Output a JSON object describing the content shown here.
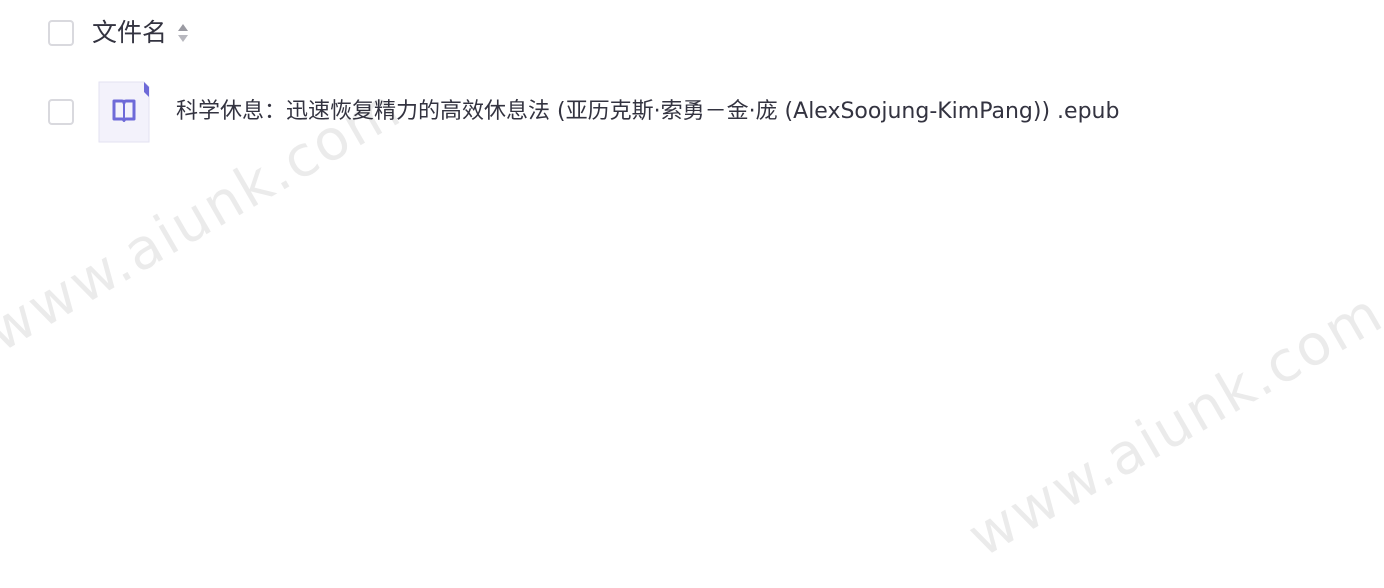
{
  "header": {
    "column_title": "文件名",
    "sort_icon": "sort-arrows-icon"
  },
  "files": [
    {
      "name": "科学休息：迅速恢复精力的高效休息法 (亚历克斯·索勇－金·庞 (AlexSoojung-KimPang)) .epub",
      "icon": "book-icon",
      "checked": false
    }
  ],
  "watermarks": [
    "www.aiunk.com",
    "www.aiunk.com"
  ],
  "colors": {
    "accent": "#6e6ad8",
    "icon_bg": "#f1f0fb",
    "text": "#333340",
    "border": "#d9d9de"
  }
}
